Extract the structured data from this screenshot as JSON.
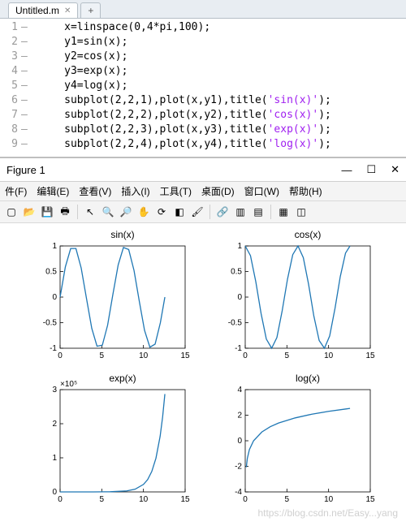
{
  "editor": {
    "tab_name": "Untitled.m",
    "lines": [
      {
        "n": "1",
        "plain": "x=linspace(0,4*pi,100);",
        "str": ""
      },
      {
        "n": "2",
        "plain": "y1=sin(x);",
        "str": ""
      },
      {
        "n": "3",
        "plain": "y2=cos(x);",
        "str": ""
      },
      {
        "n": "4",
        "plain": "y3=exp(x);",
        "str": ""
      },
      {
        "n": "5",
        "plain": "y4=log(x);",
        "str": ""
      },
      {
        "n": "6",
        "plain": "subplot(2,2,1),plot(x,y1),title(",
        "str": "'sin(x)'",
        "tail": ");"
      },
      {
        "n": "7",
        "plain": "subplot(2,2,2),plot(x,y2),title(",
        "str": "'cos(x)'",
        "tail": ");"
      },
      {
        "n": "8",
        "plain": "subplot(2,2,3),plot(x,y3),title(",
        "str": "'exp(x)'",
        "tail": ");"
      },
      {
        "n": "9",
        "plain": "subplot(2,2,4),plot(x,y4),title(",
        "str": "'log(x)'",
        "tail": ");"
      }
    ]
  },
  "figure": {
    "title": "Figure 1",
    "menu": [
      "件(F)",
      "编辑(E)",
      "查看(V)",
      "插入(I)",
      "工具(T)",
      "桌面(D)",
      "窗口(W)",
      "帮助(H)"
    ],
    "toolbar_icons": [
      "new",
      "open",
      "save",
      "print",
      "arrow",
      "zoom-in",
      "zoom-out",
      "pan",
      "rotate3d",
      "datatip",
      "brush",
      "link",
      "colorbar",
      "legend",
      "grid",
      "layout"
    ]
  },
  "watermark": "https://blog.csdn.net/Easy...yang",
  "chart_data": [
    {
      "type": "line",
      "title": "sin(x)",
      "xlabel": "",
      "ylabel": "",
      "xlim": [
        0,
        15
      ],
      "ylim": [
        -1,
        1
      ],
      "xticks": [
        0,
        5,
        10,
        15
      ],
      "yticks": [
        -1,
        -0.5,
        0,
        0.5,
        1
      ],
      "x": [
        0,
        0.63,
        1.27,
        1.9,
        2.53,
        3.17,
        3.8,
        4.43,
        5.07,
        5.7,
        6.33,
        6.97,
        7.6,
        8.23,
        8.87,
        9.5,
        10.13,
        10.77,
        11.4,
        12.03,
        12.57
      ],
      "values": [
        0,
        0.59,
        0.95,
        0.95,
        0.57,
        -0.03,
        -0.61,
        -0.96,
        -0.94,
        -0.55,
        0.05,
        0.63,
        0.97,
        0.93,
        0.52,
        -0.08,
        -0.65,
        -0.98,
        -0.92,
        -0.5,
        0.0
      ]
    },
    {
      "type": "line",
      "title": "cos(x)",
      "xlabel": "",
      "ylabel": "",
      "xlim": [
        0,
        15
      ],
      "ylim": [
        -1,
        1
      ],
      "xticks": [
        0,
        5,
        10,
        15
      ],
      "yticks": [
        -1,
        -0.5,
        0,
        0.5,
        1
      ],
      "x": [
        0,
        0.63,
        1.27,
        1.9,
        2.53,
        3.17,
        3.8,
        4.43,
        5.07,
        5.7,
        6.33,
        6.97,
        7.6,
        8.23,
        8.87,
        9.5,
        10.13,
        10.77,
        11.4,
        12.03,
        12.57
      ],
      "values": [
        1,
        0.81,
        0.3,
        -0.32,
        -0.82,
        -1.0,
        -0.79,
        -0.27,
        0.35,
        0.83,
        1.0,
        0.77,
        0.25,
        -0.37,
        -0.85,
        -1.0,
        -0.76,
        -0.22,
        0.4,
        0.86,
        1.0
      ]
    },
    {
      "type": "line",
      "title": "exp(x)",
      "xlabel": "",
      "ylabel": "",
      "y_exponent": "×10⁵",
      "xlim": [
        0,
        15
      ],
      "ylim": [
        0,
        3
      ],
      "xticks": [
        0,
        5,
        10,
        15
      ],
      "yticks": [
        0,
        1,
        2,
        3
      ],
      "x": [
        0,
        2,
        4,
        6,
        8,
        9,
        10,
        10.5,
        11,
        11.5,
        12,
        12.3,
        12.57
      ],
      "values": [
        1e-05,
        0.0001,
        0.0005,
        0.004,
        0.03,
        0.08,
        0.22,
        0.36,
        0.6,
        0.99,
        1.63,
        2.2,
        2.87
      ]
    },
    {
      "type": "line",
      "title": "log(x)",
      "xlabel": "",
      "ylabel": "",
      "xlim": [
        0,
        15
      ],
      "ylim": [
        -4,
        4
      ],
      "xticks": [
        0,
        5,
        10,
        15
      ],
      "yticks": [
        -4,
        -2,
        0,
        2,
        4
      ],
      "x": [
        0.13,
        0.25,
        0.5,
        1,
        2,
        3,
        4,
        6,
        8,
        10,
        12,
        12.57
      ],
      "values": [
        -2.07,
        -1.39,
        -0.69,
        0,
        0.69,
        1.1,
        1.39,
        1.79,
        2.08,
        2.3,
        2.48,
        2.53
      ]
    }
  ]
}
